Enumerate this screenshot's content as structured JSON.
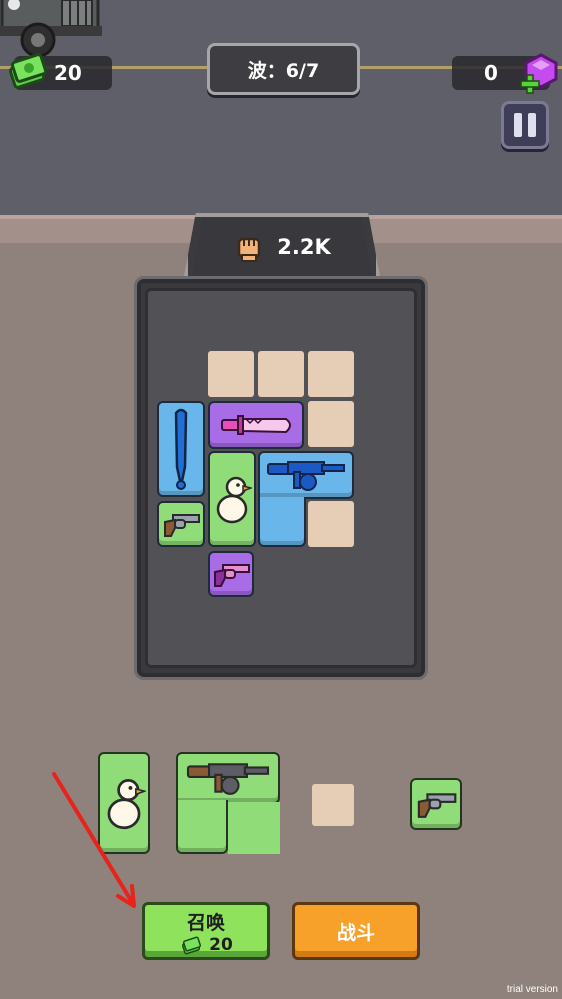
{
  "hud": {
    "cash": "20",
    "gems": "0",
    "wave_label": "波：6/7",
    "power": "2.2K"
  },
  "board": {
    "pieces": [
      {
        "name": "baseball-bat",
        "rarity": "blue"
      },
      {
        "name": "combat-knife",
        "rarity": "purple"
      },
      {
        "name": "duck",
        "rarity": "green"
      },
      {
        "name": "tommy-gun",
        "rarity": "blue"
      },
      {
        "name": "revolver",
        "rarity": "green"
      },
      {
        "name": "revolver",
        "rarity": "purple"
      }
    ]
  },
  "tray": {
    "items": [
      {
        "name": "duck",
        "rarity": "green"
      },
      {
        "name": "tommy-gun",
        "rarity": "green"
      },
      {
        "name": "empty-slot"
      },
      {
        "name": "revolver",
        "rarity": "green"
      }
    ]
  },
  "actions": {
    "summon_label": "召唤",
    "summon_cost": "20",
    "fight_label": "战斗"
  },
  "footer": {
    "trial": "trial version"
  },
  "colors": {
    "blue": "#69b7ea",
    "purple": "#a86ce6",
    "green": "#8fdc79",
    "fight": "#f7a12b",
    "summon": "#8fe25b"
  }
}
